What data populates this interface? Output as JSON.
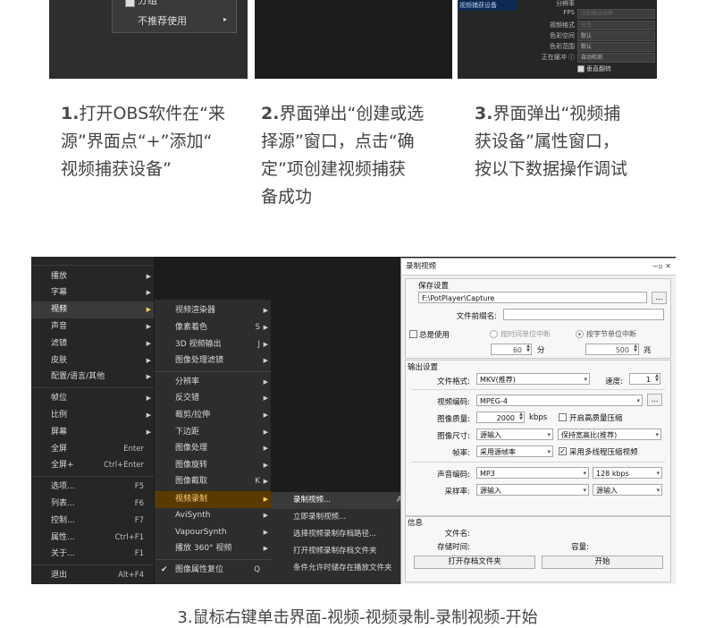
{
  "shot1": {
    "item_partial": "分组",
    "item_not_recommended": "不推荐使用"
  },
  "shot3": {
    "selected_source": "视频捕获设备",
    "labels": [
      "分辨率",
      "FPS",
      "视频格式",
      "色彩空间",
      "色彩范围",
      "正在缓冲 ⓘ"
    ],
    "values": [
      "",
      "匹配输出帧率",
      "任意",
      "默认",
      "默认",
      "自动检测"
    ],
    "flip_label": "垂直翻转"
  },
  "steps": [
    {
      "num": "1.",
      "lines": [
        "打开OBS软件在“来",
        "源”界面点“+”添加“",
        "视频捕获设备”"
      ]
    },
    {
      "num": "2.",
      "lines": [
        "界面弹出“创建或选",
        "择源”窗口，点击“确",
        "定”项创建视频捕获",
        "备成功"
      ]
    },
    {
      "num": "3.",
      "lines": [
        "界面弹出“视频捕",
        "获设备”属性窗口，",
        "按以下数据操作调试"
      ]
    }
  ],
  "context_menu": {
    "items": [
      {
        "label": "播放",
        "shortcut": "",
        "submenu": true
      },
      {
        "label": "字幕",
        "shortcut": "",
        "submenu": true
      },
      {
        "label": "视频",
        "shortcut": "",
        "submenu": true,
        "selected": true
      },
      {
        "label": "声音",
        "shortcut": "",
        "submenu": true
      },
      {
        "label": "滤镜",
        "shortcut": "",
        "submenu": true
      },
      {
        "label": "皮肤",
        "shortcut": "",
        "submenu": true
      },
      {
        "label": "配置/语言/其他",
        "shortcut": "",
        "submenu": true
      },
      {
        "label": "帧位",
        "shortcut": "",
        "submenu": true
      },
      {
        "label": "比例",
        "shortcut": "",
        "submenu": true
      },
      {
        "label": "屏幕",
        "shortcut": "",
        "submenu": true
      },
      {
        "label": "全屏",
        "shortcut": "Enter",
        "submenu": false
      },
      {
        "label": "全屏+",
        "shortcut": "Ctrl+Enter",
        "submenu": false
      },
      {
        "label": "选项...",
        "shortcut": "F5",
        "submenu": false
      },
      {
        "label": "列表...",
        "shortcut": "F6",
        "submenu": false
      },
      {
        "label": "控制...",
        "shortcut": "F7",
        "submenu": false
      },
      {
        "label": "属性...",
        "shortcut": "Ctrl+F1",
        "submenu": false
      },
      {
        "label": "关于...",
        "shortcut": "F1",
        "submenu": false
      },
      {
        "label": "退出",
        "shortcut": "Alt+F4",
        "submenu": false
      }
    ]
  },
  "video_submenu": {
    "items": [
      {
        "label": "视频渲染器",
        "shortcut": "",
        "submenu": true
      },
      {
        "label": "像素着色",
        "shortcut": "S",
        "submenu": true
      },
      {
        "label": "3D 视频输出",
        "shortcut": "J",
        "submenu": true
      },
      {
        "label": "图像处理滤镜",
        "shortcut": "",
        "submenu": true
      },
      {
        "label": "分辨率",
        "shortcut": "",
        "submenu": true
      },
      {
        "label": "反交错",
        "shortcut": "",
        "submenu": true
      },
      {
        "label": "裁剪/拉伸",
        "shortcut": "",
        "submenu": true
      },
      {
        "label": "下边距",
        "shortcut": "",
        "submenu": true
      },
      {
        "label": "图像处理",
        "shortcut": "",
        "submenu": true
      },
      {
        "label": "图像旋转",
        "shortcut": "",
        "submenu": true
      },
      {
        "label": "图像截取",
        "shortcut": "K",
        "submenu": true
      },
      {
        "label": "视频录制",
        "shortcut": "",
        "submenu": true,
        "selected": true
      },
      {
        "label": "AviSynth",
        "shortcut": "",
        "submenu": true
      },
      {
        "label": "VapourSynth",
        "shortcut": "",
        "submenu": true
      },
      {
        "label": "播放 360° 视频",
        "shortcut": "",
        "submenu": true
      },
      {
        "label": "图像属性复位",
        "shortcut": "Q",
        "submenu": false,
        "checked": true
      }
    ]
  },
  "record_submenu": {
    "items": [
      {
        "label": "录制视频...",
        "shortcut": "Al",
        "selected": true
      },
      {
        "label": "立即录制视频..."
      },
      {
        "label": "选择视频录制存档路径..."
      },
      {
        "label": "打开视频录制存档文件夹"
      },
      {
        "label": "条件允许时储存在播放文件夹"
      }
    ]
  },
  "dialog": {
    "title": "录制视频",
    "title_controls": "−▫ ✕",
    "save_group": "保存设置",
    "save_path": "F:\\PotPlayer\\Capture",
    "browse": "...",
    "prefix_label": "文件前缀名:",
    "prefix_value": "",
    "total_use": "总是使用",
    "by_time": "按时间单位中断",
    "by_bytes": "按字节单位中断",
    "minutes_value": "60",
    "minutes_unit": "分",
    "mb_value": "500",
    "mb_unit": "兆",
    "output_group": "输出设置",
    "format_label": "文件格式:",
    "format_value": "MKV(推荐)",
    "speed_label": "速度:",
    "speed_value": "1",
    "vcodec_label": "视频编码:",
    "vcodec_value": "MPEG-4",
    "quality_label": "图像质量:",
    "quality_value": "2000",
    "quality_unit": "kbps",
    "hq_compress": "开启高质量压缩",
    "size_label": "图像尺寸:",
    "size_value": "源输入",
    "aspect_value": "保持宽高比(推荐)",
    "fps_label": "帧率:",
    "fps_value": "采用源帧率",
    "multithread": "采用多线程压缩视频",
    "acodec_label": "声音编码:",
    "acodec_value": "MP3",
    "abitrate_value": "128 kbps",
    "samplerate_label": "采样率:",
    "samplerate_value": "源输入",
    "channels_value": "源输入",
    "info_group": "信息",
    "filename_label": "文件名:",
    "storetime_label": "存储时间:",
    "capacity_label": "容量:",
    "open_folder_btn": "打开存档文件夹",
    "start_btn": "开始"
  },
  "bottom_caption": "3.鼠标右键单击界面-视频-视频录制-录制视频-开始"
}
